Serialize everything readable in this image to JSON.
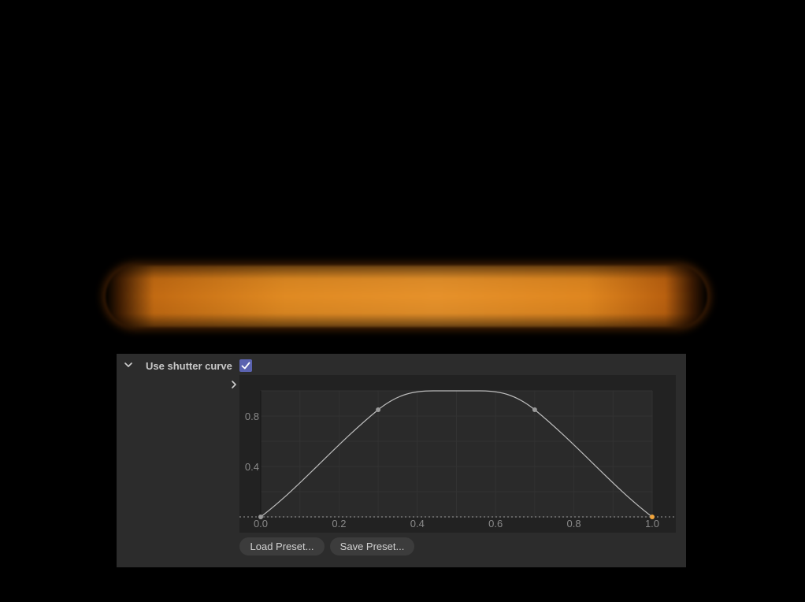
{
  "render": {
    "streak_color": "#e08a22",
    "background": "#000000"
  },
  "panel": {
    "section_label": "Use shutter curve",
    "use_shutter_curve_checked": true,
    "collapse_icon": "chevron-down-icon",
    "expand_icon": "chevron-right-icon",
    "checkbox_color": "#5b63b0"
  },
  "curve": {
    "x_ticks": [
      "0.0",
      "0.2",
      "0.4",
      "0.6",
      "0.8",
      "1.0"
    ],
    "y_ticks": [
      "0.4",
      "0.8"
    ],
    "x_range": [
      0,
      1
    ],
    "y_range": [
      0,
      1
    ],
    "points": [
      {
        "x": 0.0,
        "y": 0.0,
        "selected": false
      },
      {
        "x": 0.3,
        "y": 0.85,
        "selected": false
      },
      {
        "x": 0.7,
        "y": 0.85,
        "selected": false
      },
      {
        "x": 1.0,
        "y": 0.0,
        "selected": true
      }
    ],
    "curve_color": "#bdbdbd",
    "point_color": "#9a9a9a",
    "selected_point_color": "#f0a43c"
  },
  "buttons": {
    "load_preset": "Load Preset...",
    "save_preset": "Save Preset..."
  }
}
